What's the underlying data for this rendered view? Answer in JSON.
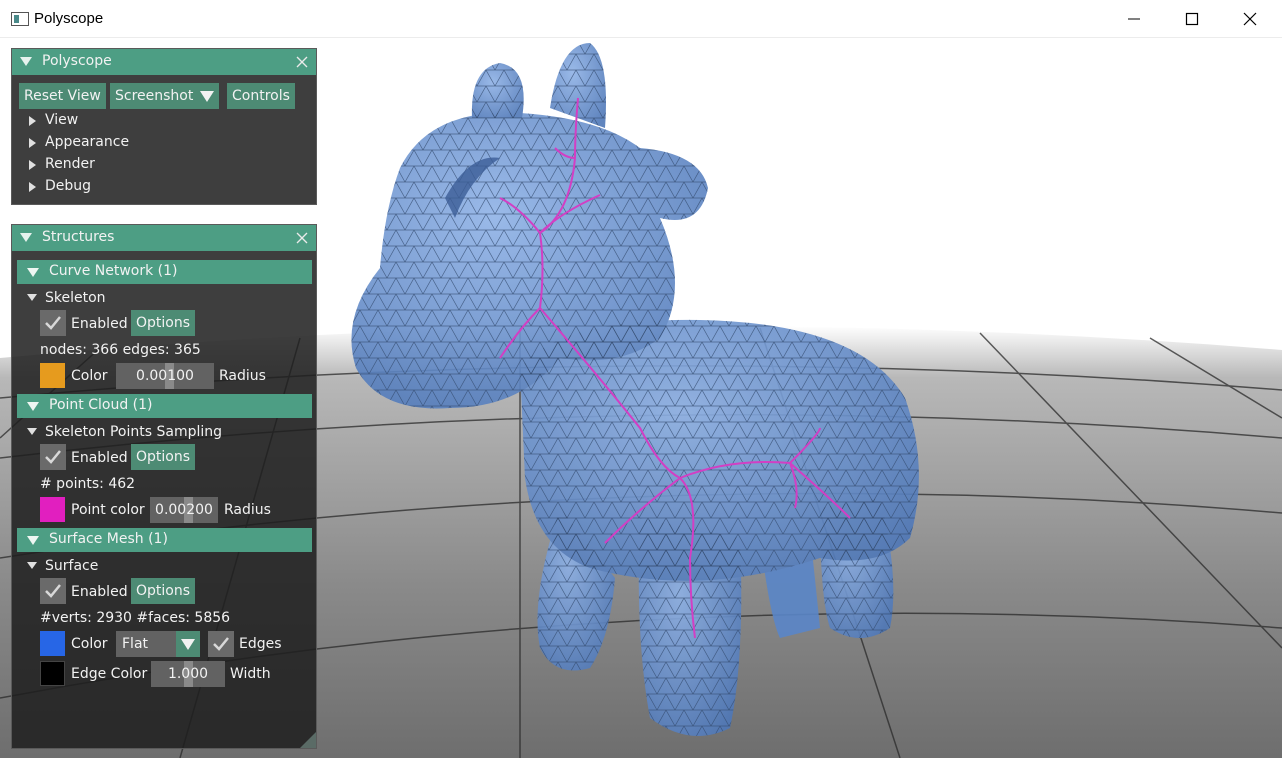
{
  "window": {
    "title": "Polyscope"
  },
  "colors": {
    "accent": "#4d9e84",
    "button": "#4d8b74",
    "skeleton": "#e69b1e",
    "points": "#e11fbf",
    "mesh": "#2766e6",
    "edge": "#000000"
  },
  "polyscope_panel": {
    "title": "Polyscope",
    "buttons": {
      "reset_view": "Reset View",
      "screenshot": "Screenshot",
      "controls": "Controls"
    },
    "tree": [
      "View",
      "Appearance",
      "Render",
      "Debug"
    ]
  },
  "structures_panel": {
    "title": "Structures",
    "curve_network": {
      "header": "Curve Network (1)",
      "name": "Skeleton",
      "enabled_label": "Enabled",
      "options_label": "Options",
      "stats": "nodes: 366  edges: 365",
      "color_label": "Color",
      "radius_value": "0.00100",
      "radius_label": "Radius"
    },
    "point_cloud": {
      "header": "Point Cloud (1)",
      "name": "Skeleton Points Sampling",
      "enabled_label": "Enabled",
      "options_label": "Options",
      "stats": "# points: 462",
      "color_label": "Point color",
      "radius_value": "0.00200",
      "radius_label": "Radius"
    },
    "surface_mesh": {
      "header": "Surface Mesh (1)",
      "name": "Surface",
      "enabled_label": "Enabled",
      "options_label": "Options",
      "stats": "#verts: 2930  #faces: 5856",
      "color_label": "Color",
      "shade_mode": "Flat",
      "edges_label": "Edges",
      "edge_color_label": "Edge Color",
      "width_value": "1.000",
      "width_label": "Width"
    }
  }
}
